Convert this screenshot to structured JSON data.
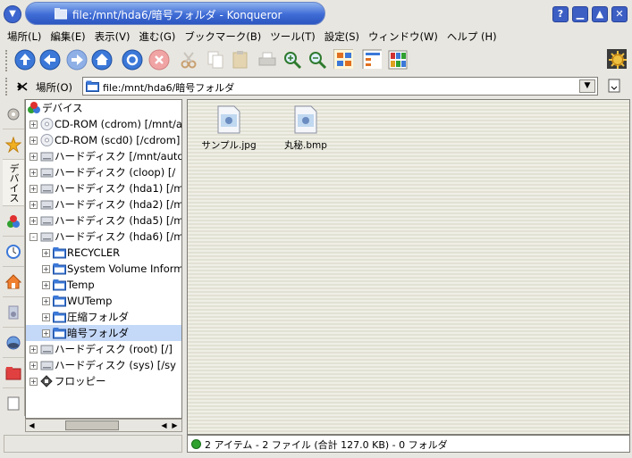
{
  "window": {
    "title": "file:/mnt/hda6/暗号フォルダ - Konqueror",
    "controls": {
      "help": "?",
      "minimize": "▁",
      "maximize": "▲",
      "close": "✕"
    }
  },
  "menubar": [
    "場所(L)",
    "編集(E)",
    "表示(V)",
    "進む(G)",
    "ブックマーク(B)",
    "ツール(T)",
    "設定(S)",
    "ウィンドウ(W)",
    "ヘルプ (H)"
  ],
  "location": {
    "label": "場所(O)",
    "value": "file:/mnt/hda6/暗号フォルダ"
  },
  "tree": {
    "root": "デバイス",
    "items": [
      {
        "label": "CD-ROM (cdrom) [/mnt/au",
        "icon": "cdrom-icon",
        "level": 1,
        "expander": "+"
      },
      {
        "label": "CD-ROM (scd0) [/cdrom]",
        "icon": "cdrom-icon",
        "level": 1,
        "expander": "+"
      },
      {
        "label": "ハードディスク  [/mnt/auto",
        "icon": "hdd-icon",
        "level": 1,
        "expander": "+"
      },
      {
        "label": "ハードディスク (cloop) [/",
        "icon": "hdd-icon",
        "level": 1,
        "expander": "+"
      },
      {
        "label": "ハードディスク (hda1) [/m",
        "icon": "hdd-icon",
        "level": 1,
        "expander": "+"
      },
      {
        "label": "ハードディスク (hda2) [/m",
        "icon": "hdd-icon",
        "level": 1,
        "expander": "+"
      },
      {
        "label": "ハードディスク (hda5) [/m",
        "icon": "hdd-icon",
        "level": 1,
        "expander": "+"
      },
      {
        "label": "ハードディスク (hda6) [/m",
        "icon": "hdd-icon",
        "level": 1,
        "expander": "-"
      },
      {
        "label": "RECYCLER",
        "icon": "folder-icon",
        "level": 2,
        "expander": "+"
      },
      {
        "label": "System Volume Informa",
        "icon": "folder-icon",
        "level": 2,
        "expander": "+"
      },
      {
        "label": "Temp",
        "icon": "folder-icon",
        "level": 2,
        "expander": "+"
      },
      {
        "label": "WUTemp",
        "icon": "folder-icon",
        "level": 2,
        "expander": "+"
      },
      {
        "label": "圧縮フォルダ",
        "icon": "folder-icon",
        "level": 2,
        "expander": "+"
      },
      {
        "label": "暗号フォルダ",
        "icon": "folder-icon",
        "level": 2,
        "expander": "+",
        "selected": true
      },
      {
        "label": "ハードディスク (root) [/]",
        "icon": "hdd-icon",
        "level": 1,
        "expander": "+"
      },
      {
        "label": "ハードディスク (sys) [/sy",
        "icon": "hdd-icon",
        "level": 1,
        "expander": "+"
      },
      {
        "label": "フロッピー",
        "icon": "floppy-icon",
        "level": 1,
        "expander": "+"
      }
    ]
  },
  "sidebar_tab_label": "デバイス",
  "files": [
    {
      "name": "サンプル.jpg",
      "icon": "image-file-icon"
    },
    {
      "name": "丸秘.bmp",
      "icon": "image-file-icon"
    }
  ],
  "status": {
    "text": "2 アイテム - 2 ファイル (合計 127.0 KB) - 0 フォルダ"
  },
  "colors": {
    "titlebar": "#3f6cd6",
    "selection": "#c4d8f8",
    "status_ok": "#2ea12e"
  }
}
